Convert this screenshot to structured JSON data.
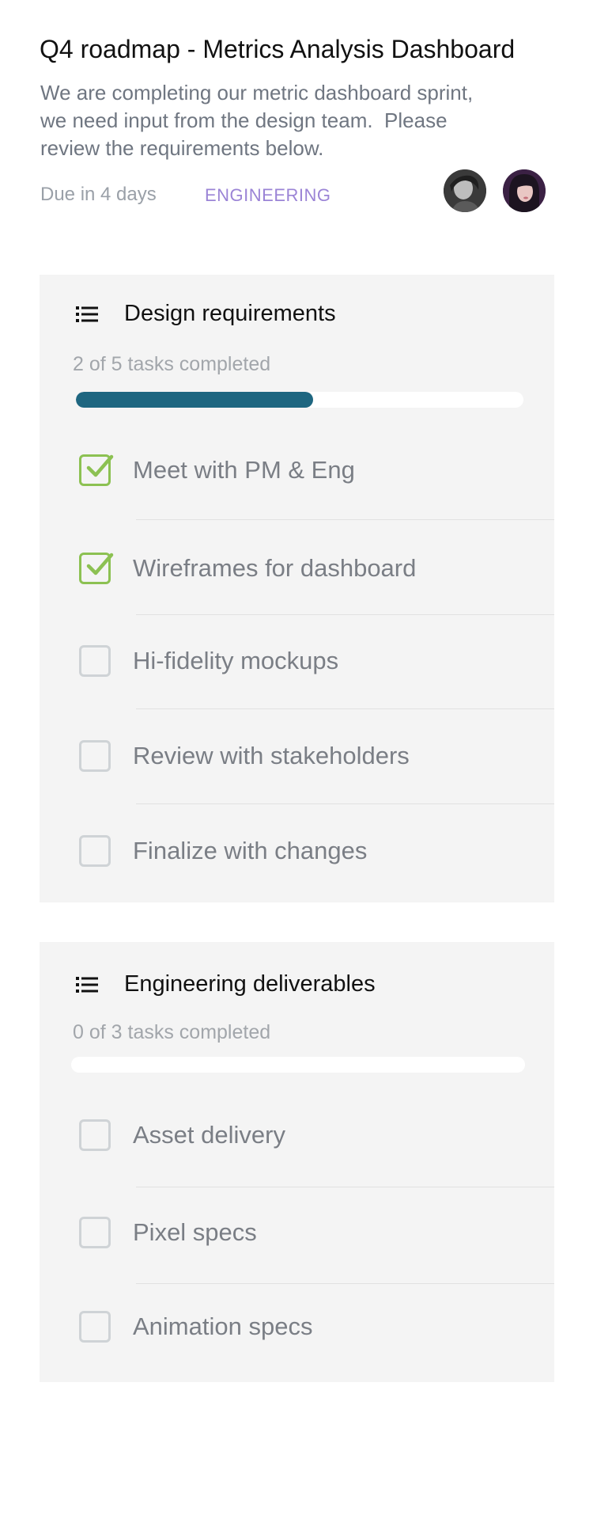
{
  "header": {
    "title": "Q4 roadmap - Metrics Analysis Dashboard",
    "description_lines": [
      "We are completing our metric dashboard sprint,",
      "we need input from the design team.  Please",
      "review the requirements below."
    ],
    "due": "Due in 4 days",
    "tag": "ENGINEERING",
    "avatars": [
      "avatar-1",
      "avatar-2"
    ]
  },
  "sections": [
    {
      "title": "Design requirements",
      "progress_text": "2 of 5 tasks completed",
      "progress": 0.53,
      "icon": "list-icon",
      "items": [
        {
          "label": "Meet with PM & Eng",
          "checked": true
        },
        {
          "label": "Wireframes for dashboard",
          "checked": true
        },
        {
          "label": "Hi-fidelity mockups",
          "checked": false
        },
        {
          "label": "Review with stakeholders",
          "checked": false
        },
        {
          "label": "Finalize with changes",
          "checked": false
        }
      ]
    },
    {
      "title": "Engineering deliverables",
      "progress_text": "0 of 3 tasks completed",
      "progress": 0,
      "icon": "list-icon",
      "items": [
        {
          "label": "Asset delivery",
          "checked": false
        },
        {
          "label": "Pixel specs",
          "checked": false
        },
        {
          "label": "Animation specs",
          "checked": false
        }
      ]
    }
  ],
  "colors": {
    "accent_progress": "#1e6680",
    "check_green": "#8cc152",
    "tag_purple": "#9b84d6",
    "card_bg": "#f4f4f4"
  }
}
